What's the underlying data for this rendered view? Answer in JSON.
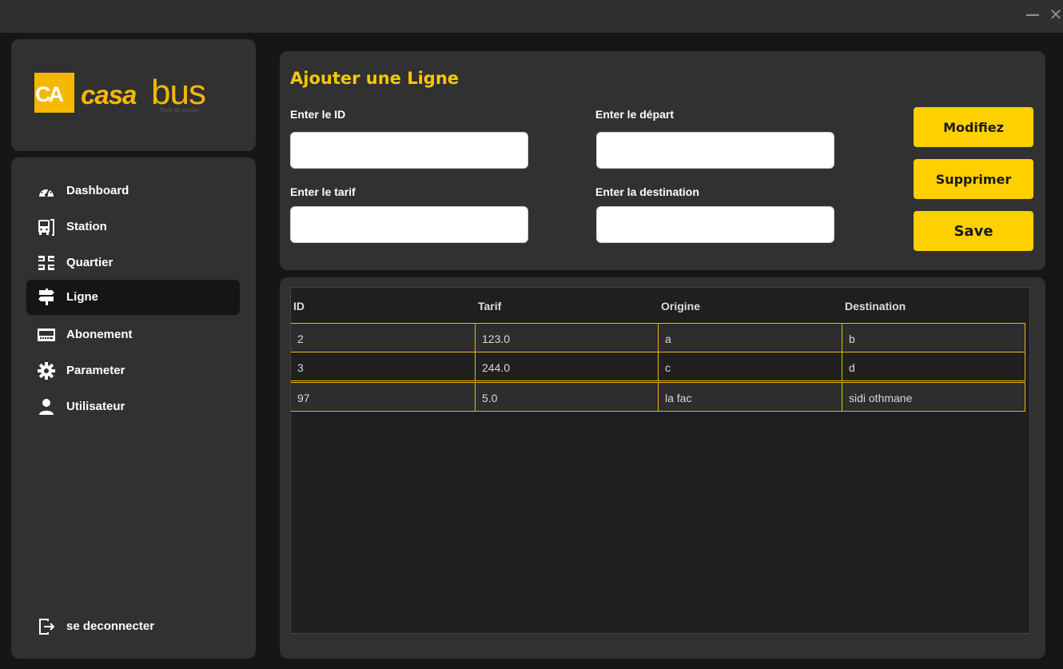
{
  "window": {
    "minimize_glyph": "—",
    "close_glyph": "✕"
  },
  "logo": {
    "mark": "CA",
    "word_casa": "casa",
    "word_bus": "bus",
    "sub": "filiale du groupe"
  },
  "sidebar": {
    "items": [
      {
        "label": "Dashboard",
        "icon": "speedometer-icon"
      },
      {
        "label": "Station",
        "icon": "bus-icon"
      },
      {
        "label": "Quartier",
        "icon": "district-grid-icon"
      },
      {
        "label": "Ligne",
        "icon": "signpost-icon",
        "active": true
      },
      {
        "label": "Abonement",
        "icon": "card-icon"
      },
      {
        "label": "Parameter",
        "icon": "gear-icon"
      },
      {
        "label": "Utilisateur",
        "icon": "user-icon"
      }
    ],
    "logout_label": "se deconnecter"
  },
  "form": {
    "title": "Ajouter une Ligne",
    "id_label": "Enter le ID",
    "depart_label": "Enter le départ",
    "tarif_label": "Enter le tarif",
    "destination_label": "Enter la destination",
    "id_value": "",
    "depart_value": "",
    "tarif_value": "",
    "destination_value": "",
    "buttons": {
      "modify": "Modifiez",
      "delete": "Supprimer",
      "save": "Save"
    }
  },
  "table": {
    "columns": [
      "ID",
      "Tarif",
      "Origine",
      "Destination"
    ],
    "rows": [
      [
        "2",
        "123.0",
        "a",
        "b"
      ],
      [
        "3",
        "244.0",
        "c",
        "d"
      ],
      [
        "97",
        "5.0",
        "la fac",
        "sidi othmane"
      ]
    ]
  },
  "colors": {
    "accent": "#ffd000",
    "panel": "#313131",
    "background": "#161616"
  }
}
